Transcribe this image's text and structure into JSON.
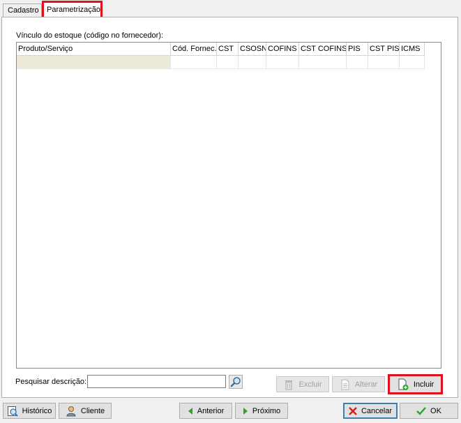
{
  "tabs": [
    {
      "label": "Cadastro"
    },
    {
      "label": "Parametrização"
    }
  ],
  "group_label": "Vínculo do estoque  (código no fornecedor):",
  "grid": {
    "columns": [
      "Produto/Serviço",
      "Cód. Fornec.",
      "CST",
      "CSOSN",
      "COFINS",
      "CST COFINS",
      "PIS",
      "CST PIS",
      "ICMS"
    ]
  },
  "search": {
    "label": "Pesquisar descrição:",
    "value": ""
  },
  "actions": {
    "excluir": "Excluir",
    "alterar": "Alterar",
    "incluir": "Incluir"
  },
  "footer": {
    "historico": "Histórico",
    "cliente": "Cliente",
    "anterior": "Anterior",
    "proximo": "Próximo",
    "cancelar": "Cancelar",
    "ok": "OK"
  },
  "colors": {
    "highlight": "#e0101c",
    "selected_cell": "#ece9d8",
    "nav_arrow": "#2aa52a",
    "cancel_x": "#d81e1e",
    "ok_check": "#2aa52a"
  }
}
